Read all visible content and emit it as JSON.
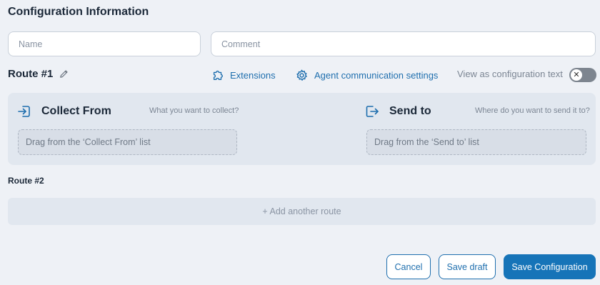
{
  "page": {
    "title": "Configuration Information"
  },
  "form": {
    "name_placeholder": "Name",
    "comment_placeholder": "Comment"
  },
  "route1": {
    "title": "Route #1",
    "edit_icon": "pencil-icon",
    "toolbar": {
      "extensions_label": "Extensions",
      "extensions_icon": "puzzle-icon",
      "agent_label": "Agent communication settings",
      "agent_icon": "gear-icon",
      "view_text_label": "View as configuration text",
      "view_text_toggle_on": false
    },
    "collect": {
      "heading": "Collect From",
      "icon": "sign-in-icon",
      "hint": "What you want to collect?",
      "drop_text": "Drag from the ‘Collect From’ list"
    },
    "send": {
      "heading": "Send to",
      "icon": "sign-out-icon",
      "hint": "Where do you want to send it to?",
      "drop_text": "Drag from the ‘Send to’ list"
    }
  },
  "route2": {
    "title": "Route #2",
    "add_label": "+ Add another route"
  },
  "actions": {
    "cancel_label": "Cancel",
    "draft_label": "Save draft",
    "save_label": "Save Configuration"
  },
  "colors": {
    "accent": "#1f6fae",
    "primary_button": "#1674b8",
    "background": "#eef1f6",
    "panel": "#e1e7ef"
  }
}
